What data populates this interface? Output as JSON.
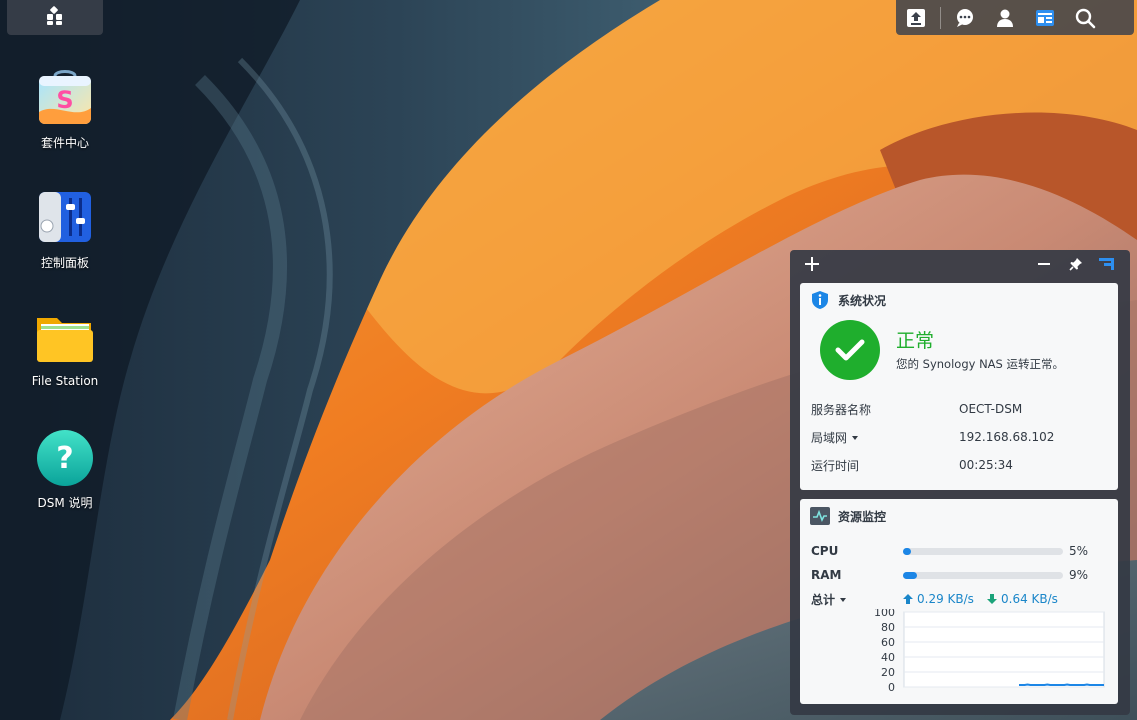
{
  "desktop": {
    "icons": [
      {
        "label": "套件中心",
        "icon": "package-center-icon"
      },
      {
        "label": "控制面板",
        "icon": "control-panel-icon"
      },
      {
        "label": "File Station",
        "icon": "folder-icon"
      },
      {
        "label": "DSM 说明",
        "icon": "help-icon"
      }
    ]
  },
  "taskbar": {
    "main_menu_icon": "grid-icon",
    "right_icons": [
      "upload-icon",
      "chat-icon",
      "user-icon",
      "widgets-icon",
      "search-icon"
    ]
  },
  "widget_panel": {
    "system_status": {
      "title": "系统状况",
      "status": "正常",
      "message": "您的 Synology NAS 运转正常。",
      "rows": [
        {
          "key": "服务器名称",
          "value": "OECT-DSM"
        },
        {
          "key": "局域网",
          "value": "192.168.68.102"
        },
        {
          "key": "运行时间",
          "value": "00:25:34"
        }
      ]
    },
    "resource_monitor": {
      "title": "资源监控",
      "cpu_label": "CPU",
      "cpu_value": "5%",
      "cpu_fraction": 0.05,
      "ram_label": "RAM",
      "ram_value": "9%",
      "ram_fraction": 0.09,
      "total_label": "总计",
      "upload": "0.29 KB/s",
      "download": "0.64 KB/s",
      "y_ticks": [
        "100",
        "80",
        "60",
        "40",
        "20",
        "0"
      ]
    }
  },
  "colors": {
    "accent": "#1c86e6",
    "ok_green": "#1fae2d",
    "net_blue": "#1a86c9"
  }
}
